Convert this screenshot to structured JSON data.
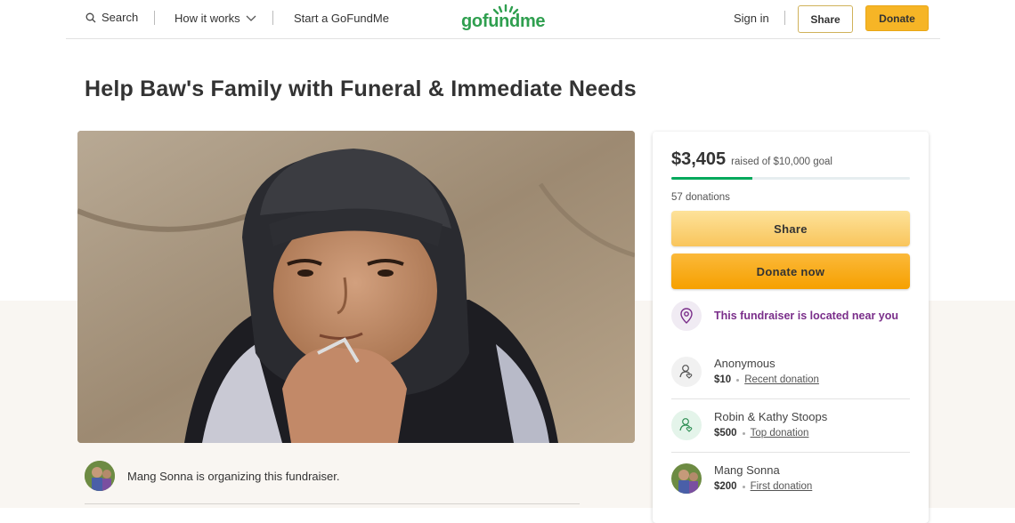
{
  "header": {
    "search_label": "Search",
    "how_it_works_label": "How it works",
    "start_label": "Start a GoFundMe",
    "logo_text": "gofundme",
    "signin_label": "Sign in",
    "share_label": "Share",
    "donate_label": "Donate"
  },
  "page": {
    "title": "Help Baw's Family with Funeral & Immediate Needs"
  },
  "organizer": {
    "text": "Mang Sonna is organizing this fundraiser."
  },
  "card": {
    "raised_amount": "$3,405",
    "raised_goal_text": "raised of $10,000 goal",
    "progress_fraction": 0.34,
    "donations_text": "57 donations",
    "share_button": "Share",
    "donate_button": "Donate now",
    "near_you_text": "This fundraiser is located near you",
    "donors": [
      {
        "name": "Anonymous",
        "amount": "$10",
        "tag": "Recent donation",
        "icon": "user-heart-icon"
      },
      {
        "name": "Robin & Kathy Stoops",
        "amount": "$500",
        "tag": "Top donation",
        "icon": "user-heart-icon"
      },
      {
        "name": "Mang Sonna",
        "amount": "$200",
        "tag": "First donation",
        "icon": "avatar"
      }
    ]
  },
  "colors": {
    "brand_green": "#02a95c",
    "donate_orange": "#f6b526",
    "purple": "#7a2e8a"
  }
}
